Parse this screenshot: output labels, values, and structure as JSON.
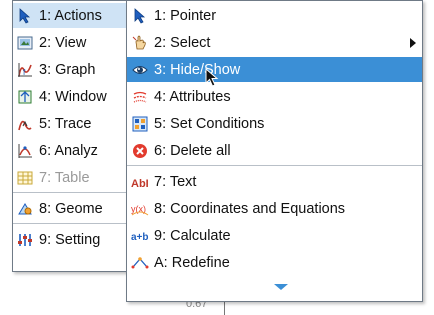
{
  "main_menu": {
    "items": [
      {
        "label": "1: Actions",
        "icon": "pointer-icon"
      },
      {
        "label": "2: View",
        "icon": "view-icon"
      },
      {
        "label": "3: Graph",
        "icon": "graph-icon"
      },
      {
        "label": "4: Window",
        "icon": "window-icon"
      },
      {
        "label": "5: Trace",
        "icon": "trace-icon"
      },
      {
        "label": "6: Analyz",
        "icon": "analyze-icon"
      },
      {
        "label": "7: Table",
        "icon": "table-icon",
        "disabled": true
      },
      {
        "label": "8: Geome",
        "icon": "geometry-icon"
      },
      {
        "label": "9: Setting",
        "icon": "settings-icon"
      }
    ]
  },
  "actions_submenu": {
    "items": [
      {
        "label": "1: Pointer",
        "icon": "pointer-icon"
      },
      {
        "label": "2: Select",
        "icon": "select-hand-icon",
        "has_submenu": true
      },
      {
        "label": "3: Hide/Show",
        "icon": "eye-icon",
        "highlighted": true
      },
      {
        "label": "4: Attributes",
        "icon": "attributes-icon"
      },
      {
        "label": "5: Set Conditions",
        "icon": "set-conditions-icon"
      },
      {
        "label": "6: Delete all",
        "icon": "delete-all-icon"
      },
      {
        "label": "7: Text",
        "icon": "text-icon"
      },
      {
        "label": "8: Coordinates and Equations",
        "icon": "coordinates-icon"
      },
      {
        "label": "9: Calculate",
        "icon": "calculate-icon"
      },
      {
        "label": "A: Redefine",
        "icon": "redefine-icon"
      }
    ]
  },
  "colors": {
    "highlight": "#3b8fd6",
    "active_parent": "#cfe3f5",
    "disabled_text": "#9a9a9a",
    "delete_red": "#e23b2e"
  }
}
